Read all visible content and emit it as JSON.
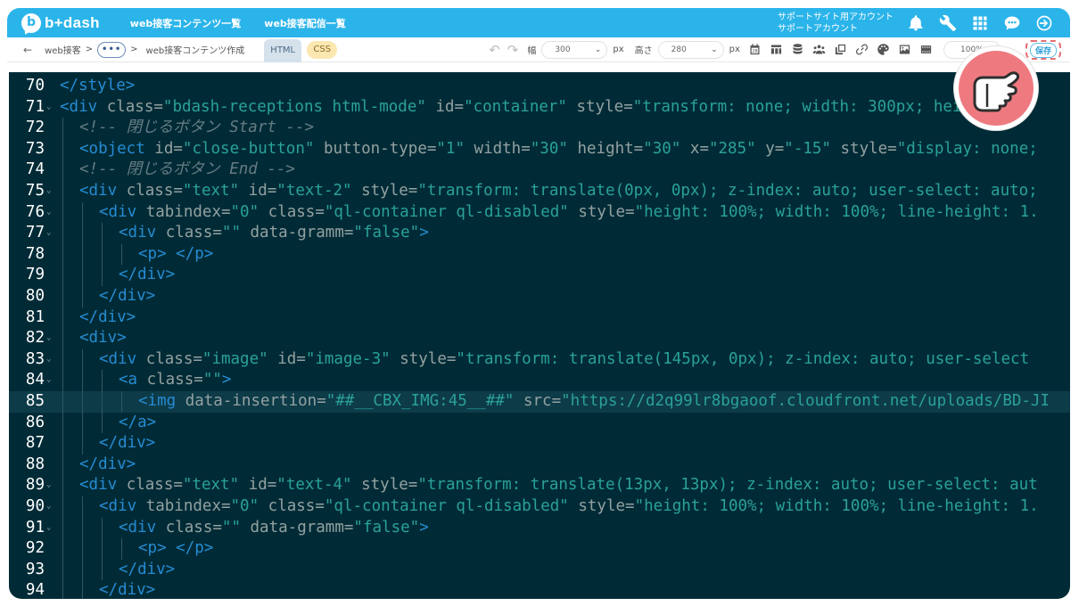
{
  "header": {
    "logo_text": "b+dash",
    "logo_mark": "b",
    "nav": [
      "web接客コンテンツ一覧",
      "web接客配信一覧"
    ],
    "support_lines": [
      "サポートサイト用アカウント",
      "サポートアカウント"
    ],
    "icons": [
      "bell-icon",
      "wrench-icon",
      "grid-icon",
      "chat-icon",
      "logout-icon"
    ]
  },
  "toolbar": {
    "back_arrow": "←",
    "breadcrumb_root": "web接客",
    "breadcrumb_sep": ">",
    "ellipsis": "•••",
    "breadcrumb_current": "web接客コンテンツ作成",
    "tab_html": "HTML",
    "tab_css": "CSS",
    "undo": "↶",
    "redo": "↷",
    "width_label": "幅",
    "width_value": "300",
    "px1": "px",
    "height_label": "高さ",
    "height_value": "280",
    "px2": "px",
    "caret": "⌄",
    "calendar_day": "28",
    "zoom_value": "100%",
    "save_label": "保存"
  },
  "accent_colors": {
    "header": "#2bb4ea",
    "editor_bg": "#002b36",
    "save_highlight": "#e46f74"
  },
  "code": {
    "lines": [
      {
        "n": "70",
        "fold": "",
        "indent": 0,
        "tokens": [
          [
            "t",
            "</style>"
          ]
        ]
      },
      {
        "n": "71",
        "fold": "⌄",
        "indent": 0,
        "tokens": [
          [
            "t",
            "<div "
          ],
          [
            "a",
            "class="
          ],
          [
            "s",
            "\"bdash-receptions html-mode\""
          ],
          [
            "a",
            " id="
          ],
          [
            "s",
            "\"container\""
          ],
          [
            "a",
            " style="
          ],
          [
            "s",
            "\"transform: none; width: 300px; height: 30"
          ]
        ]
      },
      {
        "n": "72",
        "fold": "",
        "indent": 1,
        "tokens": [
          [
            "c",
            "<!-- 閉じるボタン Start -->"
          ]
        ]
      },
      {
        "n": "73",
        "fold": "",
        "indent": 1,
        "tokens": [
          [
            "t",
            "<object "
          ],
          [
            "a",
            "id="
          ],
          [
            "s",
            "\"close-button\""
          ],
          [
            "a",
            " button-type="
          ],
          [
            "s",
            "\"1\""
          ],
          [
            "a",
            " width="
          ],
          [
            "s",
            "\"30\""
          ],
          [
            "a",
            " height="
          ],
          [
            "s",
            "\"30\""
          ],
          [
            "a",
            " x="
          ],
          [
            "s",
            "\"285\""
          ],
          [
            "a",
            " y="
          ],
          [
            "s",
            "\"-15\""
          ],
          [
            "a",
            " style="
          ],
          [
            "s",
            "\"display: none;"
          ]
        ]
      },
      {
        "n": "74",
        "fold": "",
        "indent": 1,
        "tokens": [
          [
            "c",
            "<!-- 閉じるボタン End -->"
          ]
        ]
      },
      {
        "n": "75",
        "fold": "⌄",
        "indent": 1,
        "tokens": [
          [
            "t",
            "<div "
          ],
          [
            "a",
            "class="
          ],
          [
            "s",
            "\"text\""
          ],
          [
            "a",
            " id="
          ],
          [
            "s",
            "\"text-2\""
          ],
          [
            "a",
            " style="
          ],
          [
            "s",
            "\"transform: translate(0px, 0px); z-index: auto; user-select: auto;"
          ]
        ]
      },
      {
        "n": "76",
        "fold": "⌄",
        "indent": 2,
        "tokens": [
          [
            "t",
            "<div "
          ],
          [
            "a",
            "tabindex="
          ],
          [
            "s",
            "\"0\""
          ],
          [
            "a",
            " class="
          ],
          [
            "s",
            "\"ql-container ql-disabled\""
          ],
          [
            "a",
            " style="
          ],
          [
            "s",
            "\"height: 100%; width: 100%; line-height: 1."
          ]
        ]
      },
      {
        "n": "77",
        "fold": "⌄",
        "indent": 3,
        "tokens": [
          [
            "t",
            "<div "
          ],
          [
            "a",
            "class="
          ],
          [
            "s",
            "\"\""
          ],
          [
            "a",
            " data-gramm="
          ],
          [
            "s",
            "\"false\""
          ],
          [
            "t",
            ">"
          ]
        ]
      },
      {
        "n": "78",
        "fold": "",
        "indent": 4,
        "tokens": [
          [
            "t",
            "<p>"
          ],
          [
            "p",
            " "
          ],
          [
            "t",
            "</p>"
          ]
        ]
      },
      {
        "n": "79",
        "fold": "",
        "indent": 3,
        "tokens": [
          [
            "t",
            "</div>"
          ]
        ]
      },
      {
        "n": "80",
        "fold": "",
        "indent": 2,
        "tokens": [
          [
            "t",
            "</div>"
          ]
        ]
      },
      {
        "n": "81",
        "fold": "",
        "indent": 1,
        "tokens": [
          [
            "t",
            "</div>"
          ]
        ]
      },
      {
        "n": "82",
        "fold": "⌄",
        "indent": 1,
        "tokens": [
          [
            "t",
            "<div>"
          ]
        ]
      },
      {
        "n": "83",
        "fold": "⌄",
        "indent": 2,
        "tokens": [
          [
            "t",
            "<div "
          ],
          [
            "a",
            "class="
          ],
          [
            "s",
            "\"image\""
          ],
          [
            "a",
            " id="
          ],
          [
            "s",
            "\"image-3\""
          ],
          [
            "a",
            " style="
          ],
          [
            "s",
            "\"transform: translate(145px, 0px); z-index: auto; user-select"
          ]
        ]
      },
      {
        "n": "84",
        "fold": "⌄",
        "indent": 3,
        "tokens": [
          [
            "t",
            "<a "
          ],
          [
            "a",
            "class="
          ],
          [
            "s",
            "\"\""
          ],
          [
            "t",
            ">"
          ]
        ]
      },
      {
        "n": "85",
        "fold": "",
        "indent": 4,
        "highlight": true,
        "tokens": [
          [
            "t",
            "<img "
          ],
          [
            "a",
            "data-insertion="
          ],
          [
            "s",
            "\"##__CBX_IMG:45__##\""
          ],
          [
            "a",
            " src="
          ],
          [
            "s",
            "\"https://d2q99lr8bgaoof.cloudfront.net/uploads/BD-JI"
          ]
        ]
      },
      {
        "n": "86",
        "fold": "",
        "indent": 3,
        "tokens": [
          [
            "t",
            "</a>"
          ]
        ]
      },
      {
        "n": "87",
        "fold": "",
        "indent": 2,
        "tokens": [
          [
            "t",
            "</div>"
          ]
        ]
      },
      {
        "n": "88",
        "fold": "",
        "indent": 1,
        "tokens": [
          [
            "t",
            "</div>"
          ]
        ]
      },
      {
        "n": "89",
        "fold": "⌄",
        "indent": 1,
        "tokens": [
          [
            "t",
            "<div "
          ],
          [
            "a",
            "class="
          ],
          [
            "s",
            "\"text\""
          ],
          [
            "a",
            " id="
          ],
          [
            "s",
            "\"text-4\""
          ],
          [
            "a",
            " style="
          ],
          [
            "s",
            "\"transform: translate(13px, 13px); z-index: auto; user-select: aut"
          ]
        ]
      },
      {
        "n": "90",
        "fold": "⌄",
        "indent": 2,
        "tokens": [
          [
            "t",
            "<div "
          ],
          [
            "a",
            "tabindex="
          ],
          [
            "s",
            "\"0\""
          ],
          [
            "a",
            " class="
          ],
          [
            "s",
            "\"ql-container ql-disabled\""
          ],
          [
            "a",
            " style="
          ],
          [
            "s",
            "\"height: 100%; width: 100%; line-height: 1."
          ]
        ]
      },
      {
        "n": "91",
        "fold": "⌄",
        "indent": 3,
        "tokens": [
          [
            "t",
            "<div "
          ],
          [
            "a",
            "class="
          ],
          [
            "s",
            "\"\""
          ],
          [
            "a",
            " data-gramm="
          ],
          [
            "s",
            "\"false\""
          ],
          [
            "t",
            ">"
          ]
        ]
      },
      {
        "n": "92",
        "fold": "",
        "indent": 4,
        "tokens": [
          [
            "t",
            "<p>"
          ],
          [
            "p",
            " "
          ],
          [
            "t",
            "</p>"
          ]
        ]
      },
      {
        "n": "93",
        "fold": "",
        "indent": 3,
        "tokens": [
          [
            "t",
            "</div>"
          ]
        ]
      },
      {
        "n": "94",
        "fold": "",
        "indent": 2,
        "tokens": [
          [
            "t",
            "</div>"
          ]
        ]
      }
    ]
  }
}
